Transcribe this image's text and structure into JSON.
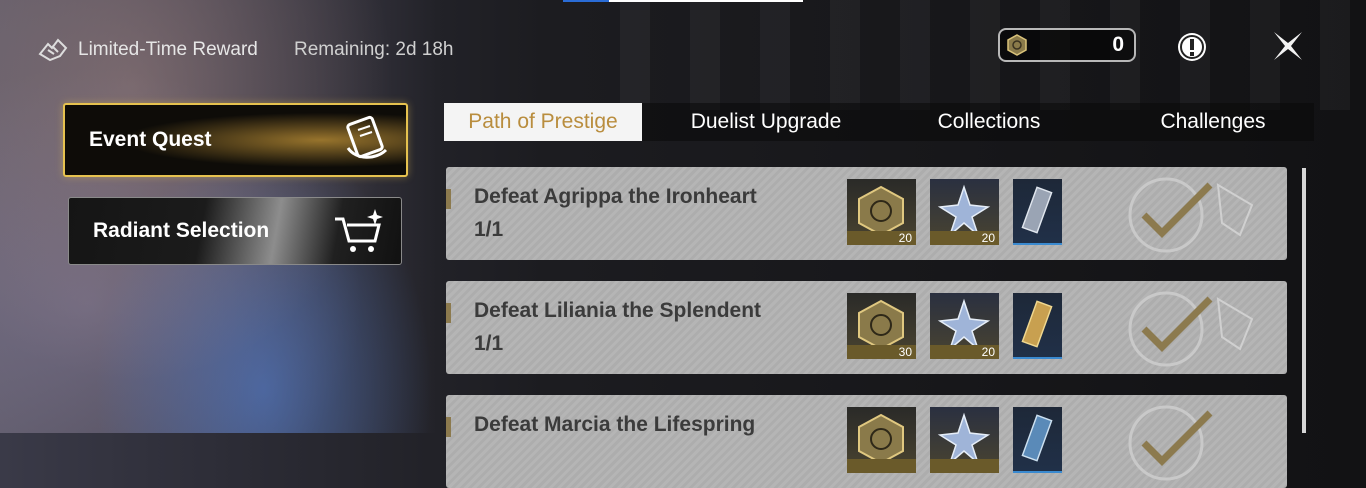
{
  "header": {
    "event_title": "Limited-Time Reward",
    "remaining": "Remaining: 2d 18h",
    "currency_value": "0",
    "currency_icon": "medal-coin-icon",
    "info_icon": "exclamation-icon",
    "close_icon": "close-x-icon"
  },
  "sidebar": {
    "items": [
      {
        "label": "Event Quest",
        "icon": "scroll-icon",
        "active": true
      },
      {
        "label": "Radiant Selection",
        "icon": "cart-icon",
        "active": false
      }
    ]
  },
  "tabs": [
    {
      "label": "Path of Prestige",
      "active": true
    },
    {
      "label": "Duelist Upgrade",
      "active": false
    },
    {
      "label": "Collections",
      "active": false
    },
    {
      "label": "Challenges",
      "active": false
    }
  ],
  "quests": [
    {
      "name": "Defeat Agrippa the Ironheart",
      "progress": "1/1",
      "rewards": [
        {
          "icon": "medal-coin-icon",
          "qty": "20"
        },
        {
          "icon": "crystal-star-icon",
          "qty": "20"
        },
        {
          "icon": "card-item-icon",
          "qty": ""
        }
      ],
      "completed": true
    },
    {
      "name": "Defeat Liliania the Splendent",
      "progress": "1/1",
      "rewards": [
        {
          "icon": "medal-coin-icon",
          "qty": "30"
        },
        {
          "icon": "crystal-star-icon",
          "qty": "20"
        },
        {
          "icon": "card-item-icon",
          "qty": ""
        }
      ],
      "completed": true
    },
    {
      "name": "Defeat Marcia the Lifespring",
      "progress": "",
      "rewards": [
        {
          "icon": "medal-coin-icon",
          "qty": ""
        },
        {
          "icon": "crystal-star-icon",
          "qty": ""
        },
        {
          "icon": "card-item-icon",
          "qty": ""
        }
      ],
      "completed": true
    }
  ],
  "colors": {
    "accent_gold": "#e6c24f",
    "tab_active_text": "#b98d3e",
    "checkmark": "#8c7a4e"
  }
}
